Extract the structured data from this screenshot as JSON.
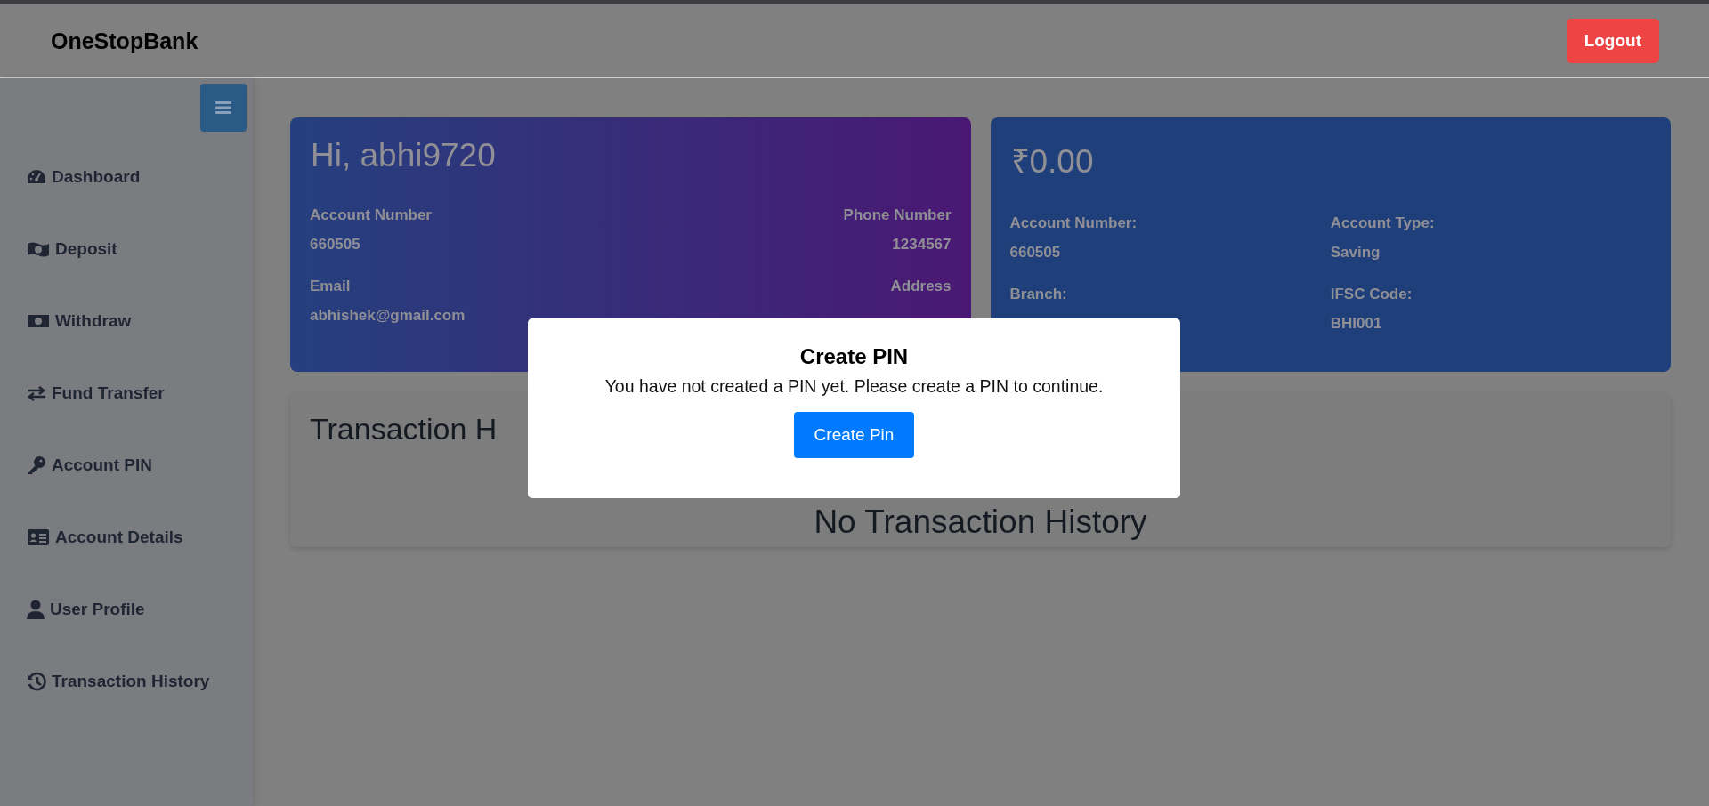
{
  "header": {
    "brand": "OneStopBank",
    "logout": "Logout"
  },
  "sidebar": {
    "items": [
      {
        "label": "Dashboard"
      },
      {
        "label": "Deposit"
      },
      {
        "label": "Withdraw"
      },
      {
        "label": "Fund Transfer"
      },
      {
        "label": "Account PIN"
      },
      {
        "label": "Account Details"
      },
      {
        "label": "User Profile"
      },
      {
        "label": "Transaction History"
      }
    ]
  },
  "profile_card": {
    "greeting": "Hi, abhi9720",
    "fields": [
      {
        "label": "Account Number",
        "value": "660505"
      },
      {
        "label": "Phone Number",
        "value": "1234567"
      },
      {
        "label": "Email",
        "value": "abhishek@gmail.com"
      },
      {
        "label": "Address"
      }
    ]
  },
  "balance_card": {
    "balance": "₹0.00",
    "fields": [
      {
        "label": "Account Number:",
        "value": "660505"
      },
      {
        "label": "Account Type:",
        "value": "Saving"
      },
      {
        "label": "Branch:"
      },
      {
        "label": "IFSC Code:",
        "value": "BHI001"
      }
    ]
  },
  "transactions": {
    "title": "Transaction H",
    "empty_message": "No Transaction History"
  },
  "modal": {
    "title": "Create PIN",
    "message": "You have not created a PIN yet. Please create a PIN to continue.",
    "button": "Create Pin"
  }
}
